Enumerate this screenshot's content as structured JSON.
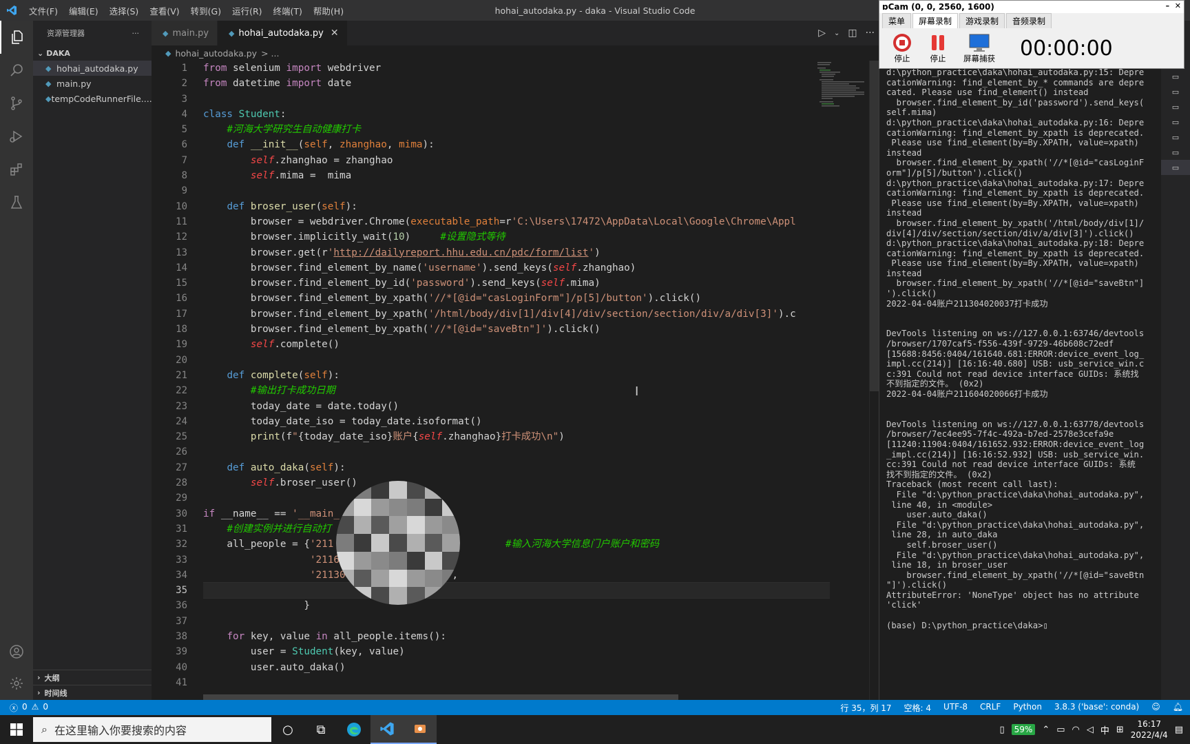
{
  "window": {
    "title": "hohai_autodaka.py - daka - Visual Studio Code",
    "menu": [
      "文件(F)",
      "编辑(E)",
      "选择(S)",
      "查看(V)",
      "转到(G)",
      "运行(R)",
      "终端(T)",
      "帮助(H)"
    ]
  },
  "sidebar": {
    "header": "资源管理器",
    "folder": "DAKA",
    "files": [
      "hohai_autodaka.py",
      "main.py",
      "tempCodeRunnerFile...."
    ],
    "outline": "大纲",
    "timeline": "时间线"
  },
  "tabs": [
    {
      "label": "main.py"
    },
    {
      "label": "hohai_autodaka.py"
    }
  ],
  "breadcrumb": {
    "file": "hohai_autodaka.py",
    "rest": "> ..."
  },
  "editor": {
    "line_numbers": [
      "1",
      "2",
      "3",
      "4",
      "5",
      "6",
      "7",
      "8",
      "9",
      "10",
      "11",
      "12",
      "13",
      "14",
      "15",
      "16",
      "17",
      "18",
      "19",
      "20",
      "21",
      "22",
      "23",
      "24",
      "25",
      "26",
      "27",
      "28",
      "29",
      "30",
      "31",
      "32",
      "33",
      "34",
      "35",
      "36",
      "37",
      "38",
      "39",
      "40",
      "41"
    ],
    "current_line": 35
  },
  "terminal": {
    "text": "d:\\python_practice\\daka\\hohai_autodaka.py:15: Depre\ncationWarning: find_element_by_* commands are depre\ncated. Please use find_element() instead\n  browser.find_element_by_id('password').send_keys(\nself.mima)\nd:\\python_practice\\daka\\hohai_autodaka.py:16: Depre\ncationWarning: find_element_by_xpath is deprecated.\n Please use find_element(by=By.XPATH, value=xpath)\ninstead\n  browser.find_element_by_xpath('//*[@id=\"casLoginF\norm\"]/p[5]/button').click()\nd:\\python_practice\\daka\\hohai_autodaka.py:17: Depre\ncationWarning: find_element_by_xpath is deprecated.\n Please use find_element(by=By.XPATH, value=xpath)\ninstead\n  browser.find_element_by_xpath('/html/body/div[1]/\ndiv[4]/div/section/section/div/a/div[3]').click()\nd:\\python_practice\\daka\\hohai_autodaka.py:18: Depre\ncationWarning: find_element_by_xpath is deprecated.\n Please use find_element(by=By.XPATH, value=xpath)\ninstead\n  browser.find_element_by_xpath('//*[@id=\"saveBtn\"]\n').click()\n2022-04-04账户211304020037打卡成功\n\n\nDevTools listening on ws://127.0.0.1:63746/devtools\n/browser/1707caf5-f556-439f-9729-46b608c72edf\n[15688:8456:0404/161640.681:ERROR:device_event_log_\nimpl.cc(214)] [16:16:40.680] USB: usb_service_win.c\nc:391 Could not read device interface GUIDs: 系统找\n不到指定的文件。 (0x2)\n2022-04-04账户211604020066打卡成功\n\n\nDevTools listening on ws://127.0.0.1:63778/devtools\n/browser/7ec4ee95-7f4c-492a-b7ed-2578e3cefa9e\n[11240:11904:0404/161652.932:ERROR:device_event_log\n_impl.cc(214)] [16:16:52.932] USB: usb_service_win.\ncc:391 Could not read device interface GUIDs: 系统\n找不到指定的文件。 (0x2)\nTraceback (most recent call last):\n  File \"d:\\python_practice\\daka\\hohai_autodaka.py\",\n line 40, in <module>\n    user.auto_daka()\n  File \"d:\\python_practice\\daka\\hohai_autodaka.py\",\n line 28, in auto_daka\n    self.broser_user()\n  File \"d:\\python_practice\\daka\\hohai_autodaka.py\",\n line 18, in broser_user\n    browser.find_element_by_xpath('//*[@id=\"saveBtn\n\"]').click()\nAttributeError: 'NoneType' object has no attribute\n'click'\n\n(base) D:\\python_practice\\daka>▯"
  },
  "bdcam": {
    "caption": "ɒCam (0, 0, 2560, 1600)",
    "tabs": [
      "菜单",
      "屏幕录制",
      "游戏录制",
      "音频录制"
    ],
    "active_tab": "屏幕录制",
    "buttons": [
      "停止",
      "停止",
      "屏幕捕获"
    ],
    "timer": "00:00:00"
  },
  "statusbar": {
    "errors": "0",
    "warnings": "0",
    "position": "行 35，列 17",
    "spaces": "空格: 4",
    "encoding": "UTF-8",
    "eol": "CRLF",
    "language": "Python",
    "interpreter": "3.8.3 ('base': conda)"
  },
  "taskbar": {
    "search_placeholder": "在这里输入你要搜索的内容",
    "battery": "59%",
    "ime": "中",
    "time": "16:17",
    "date": "2022/4/4"
  },
  "colors": {
    "accent": "#007acc",
    "editor_bg": "#1e1e1e",
    "sidebar_bg": "#252526",
    "activity_bg": "#333333"
  }
}
